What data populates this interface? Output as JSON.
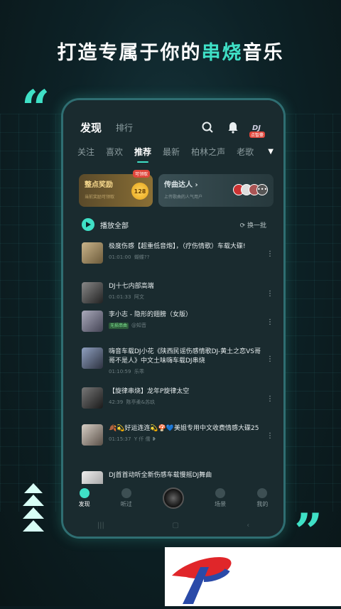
{
  "promo": {
    "headline_pre": "打造专属于你的",
    "headline_highlight": "串烧",
    "headline_post": "音乐"
  },
  "header": {
    "tab_discover": "发现",
    "tab_rank": "排行",
    "dj_label": "DJ",
    "dj_badge": "点智豪"
  },
  "tabs": [
    "关注",
    "喜欢",
    "推荐",
    "最新",
    "柏林之声",
    "老歌"
  ],
  "active_tab": "推荐",
  "cards": {
    "reward_title": "整点奖励",
    "reward_sub": "当前奖励可领取",
    "reward_tag": "可领取",
    "reward_value": "128",
    "expert_title": "传曲达人 ›",
    "expert_sub": "上传歌曲的人气用户"
  },
  "play_all": "播放全部",
  "refresh": "换一批",
  "songs": [
    {
      "title": "极度伤感【超重低音炮】，（疗伤情歌）车载大碟!",
      "duration": "01:01:00",
      "author": "蝴蝶??"
    },
    {
      "title": "DJ十七内部高端",
      "duration": "01:01:33",
      "author": "阿文"
    },
    {
      "title": "李小志 - 隐形的翅膀（女版）",
      "lossless": "无损串曲",
      "author": "@知音"
    },
    {
      "title": "嗨音车载DJ小花《陕西民谣伤感情歌DJ-黄土之恋VS哥哥不是人》中文土味嗨车载DJ串烧",
      "duration": "01:10:59",
      "author": "乐乖"
    },
    {
      "title": "【旋律串烧】龙年P旋律太空",
      "duration": "42:39",
      "author": "陈亭柔&苏玖"
    },
    {
      "title": "🍂💫好运连连💫🍄💙美姐专用中文收费情感大碟25",
      "duration": "01:15:37",
      "author": "Y 仟 儒 ❥"
    },
    {
      "title": "DJ首首动听全新伤感车载慢摇DJ舞曲",
      "duration": "",
      "author": ""
    }
  ],
  "nav": [
    "发现",
    "听过",
    "",
    "场景",
    "我的"
  ],
  "colors": {
    "accent": "#3fe0c6",
    "gold": "#f6d88d"
  }
}
